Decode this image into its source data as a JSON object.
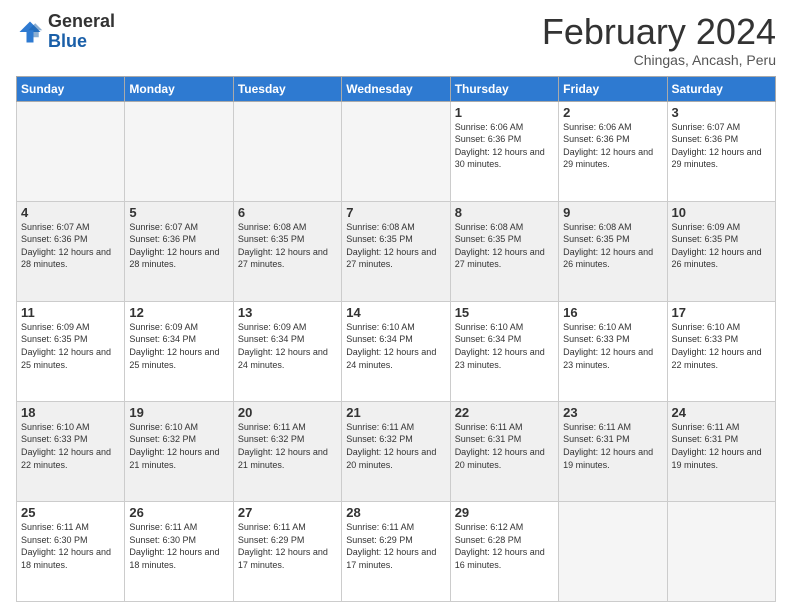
{
  "logo": {
    "general": "General",
    "blue": "Blue"
  },
  "header": {
    "month": "February 2024",
    "location": "Chingas, Ancash, Peru"
  },
  "days_of_week": [
    "Sunday",
    "Monday",
    "Tuesday",
    "Wednesday",
    "Thursday",
    "Friday",
    "Saturday"
  ],
  "weeks": [
    [
      {
        "day": "",
        "info": ""
      },
      {
        "day": "",
        "info": ""
      },
      {
        "day": "",
        "info": ""
      },
      {
        "day": "",
        "info": ""
      },
      {
        "day": "1",
        "info": "Sunrise: 6:06 AM\nSunset: 6:36 PM\nDaylight: 12 hours and 30 minutes."
      },
      {
        "day": "2",
        "info": "Sunrise: 6:06 AM\nSunset: 6:36 PM\nDaylight: 12 hours and 29 minutes."
      },
      {
        "day": "3",
        "info": "Sunrise: 6:07 AM\nSunset: 6:36 PM\nDaylight: 12 hours and 29 minutes."
      }
    ],
    [
      {
        "day": "4",
        "info": "Sunrise: 6:07 AM\nSunset: 6:36 PM\nDaylight: 12 hours and 28 minutes."
      },
      {
        "day": "5",
        "info": "Sunrise: 6:07 AM\nSunset: 6:36 PM\nDaylight: 12 hours and 28 minutes."
      },
      {
        "day": "6",
        "info": "Sunrise: 6:08 AM\nSunset: 6:35 PM\nDaylight: 12 hours and 27 minutes."
      },
      {
        "day": "7",
        "info": "Sunrise: 6:08 AM\nSunset: 6:35 PM\nDaylight: 12 hours and 27 minutes."
      },
      {
        "day": "8",
        "info": "Sunrise: 6:08 AM\nSunset: 6:35 PM\nDaylight: 12 hours and 27 minutes."
      },
      {
        "day": "9",
        "info": "Sunrise: 6:08 AM\nSunset: 6:35 PM\nDaylight: 12 hours and 26 minutes."
      },
      {
        "day": "10",
        "info": "Sunrise: 6:09 AM\nSunset: 6:35 PM\nDaylight: 12 hours and 26 minutes."
      }
    ],
    [
      {
        "day": "11",
        "info": "Sunrise: 6:09 AM\nSunset: 6:35 PM\nDaylight: 12 hours and 25 minutes."
      },
      {
        "day": "12",
        "info": "Sunrise: 6:09 AM\nSunset: 6:34 PM\nDaylight: 12 hours and 25 minutes."
      },
      {
        "day": "13",
        "info": "Sunrise: 6:09 AM\nSunset: 6:34 PM\nDaylight: 12 hours and 24 minutes."
      },
      {
        "day": "14",
        "info": "Sunrise: 6:10 AM\nSunset: 6:34 PM\nDaylight: 12 hours and 24 minutes."
      },
      {
        "day": "15",
        "info": "Sunrise: 6:10 AM\nSunset: 6:34 PM\nDaylight: 12 hours and 23 minutes."
      },
      {
        "day": "16",
        "info": "Sunrise: 6:10 AM\nSunset: 6:33 PM\nDaylight: 12 hours and 23 minutes."
      },
      {
        "day": "17",
        "info": "Sunrise: 6:10 AM\nSunset: 6:33 PM\nDaylight: 12 hours and 22 minutes."
      }
    ],
    [
      {
        "day": "18",
        "info": "Sunrise: 6:10 AM\nSunset: 6:33 PM\nDaylight: 12 hours and 22 minutes."
      },
      {
        "day": "19",
        "info": "Sunrise: 6:10 AM\nSunset: 6:32 PM\nDaylight: 12 hours and 21 minutes."
      },
      {
        "day": "20",
        "info": "Sunrise: 6:11 AM\nSunset: 6:32 PM\nDaylight: 12 hours and 21 minutes."
      },
      {
        "day": "21",
        "info": "Sunrise: 6:11 AM\nSunset: 6:32 PM\nDaylight: 12 hours and 20 minutes."
      },
      {
        "day": "22",
        "info": "Sunrise: 6:11 AM\nSunset: 6:31 PM\nDaylight: 12 hours and 20 minutes."
      },
      {
        "day": "23",
        "info": "Sunrise: 6:11 AM\nSunset: 6:31 PM\nDaylight: 12 hours and 19 minutes."
      },
      {
        "day": "24",
        "info": "Sunrise: 6:11 AM\nSunset: 6:31 PM\nDaylight: 12 hours and 19 minutes."
      }
    ],
    [
      {
        "day": "25",
        "info": "Sunrise: 6:11 AM\nSunset: 6:30 PM\nDaylight: 12 hours and 18 minutes."
      },
      {
        "day": "26",
        "info": "Sunrise: 6:11 AM\nSunset: 6:30 PM\nDaylight: 12 hours and 18 minutes."
      },
      {
        "day": "27",
        "info": "Sunrise: 6:11 AM\nSunset: 6:29 PM\nDaylight: 12 hours and 17 minutes."
      },
      {
        "day": "28",
        "info": "Sunrise: 6:11 AM\nSunset: 6:29 PM\nDaylight: 12 hours and 17 minutes."
      },
      {
        "day": "29",
        "info": "Sunrise: 6:12 AM\nSunset: 6:28 PM\nDaylight: 12 hours and 16 minutes."
      },
      {
        "day": "",
        "info": ""
      },
      {
        "day": "",
        "info": ""
      }
    ]
  ]
}
